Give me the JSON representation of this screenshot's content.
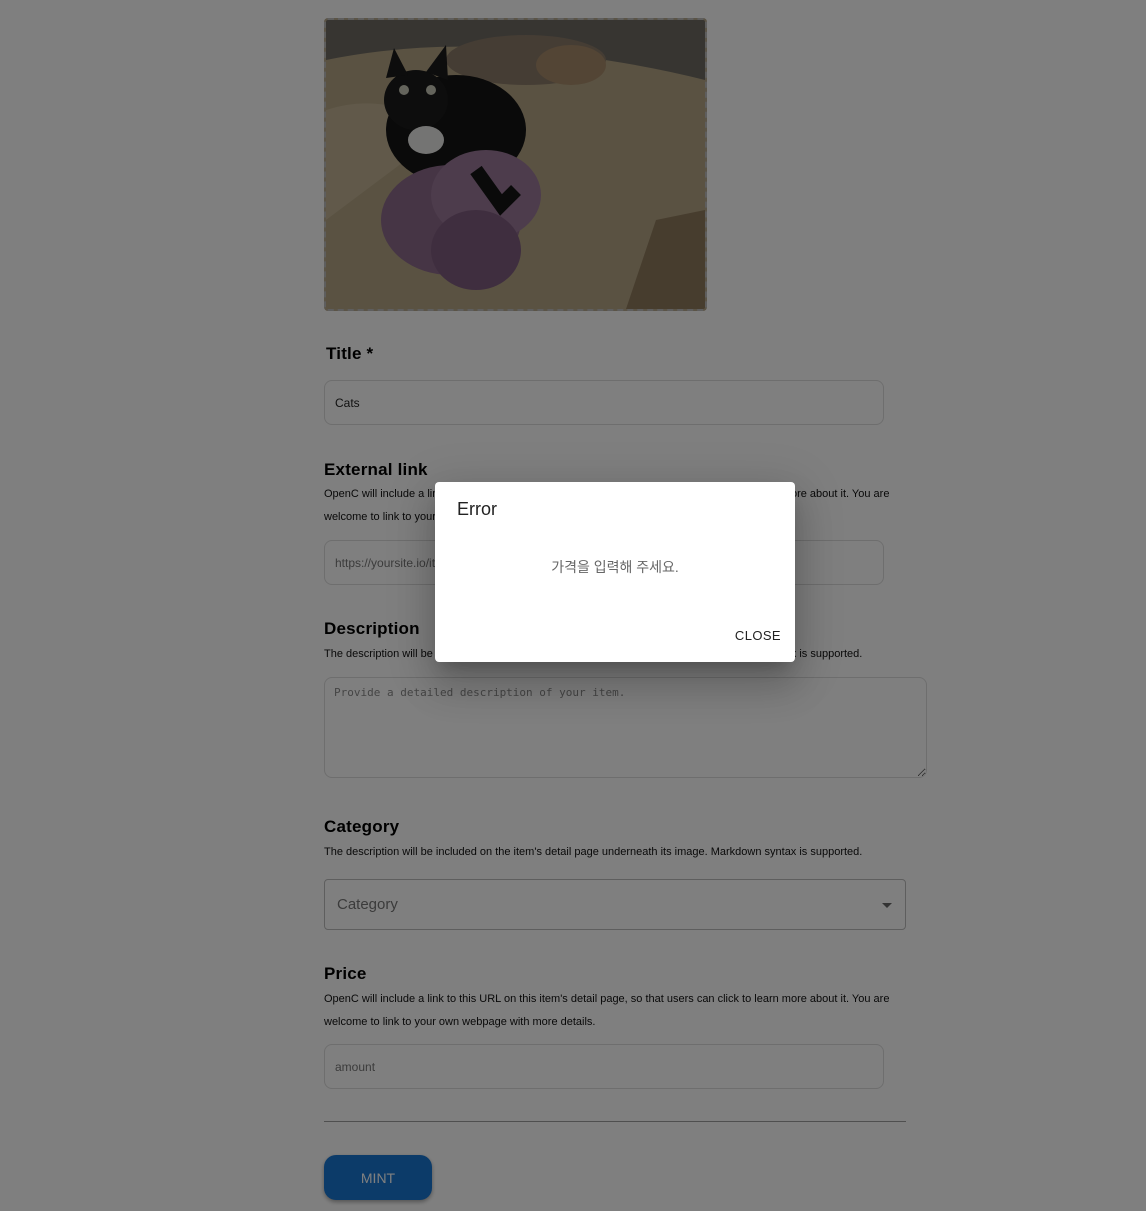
{
  "form": {
    "title_label": "Title *",
    "title_value": "Cats",
    "external_link": {
      "label": "External link",
      "help": "OpenC will include a link to this URL on this item's detail page, so that users can click to learn more about it. You are welcome to link to your own webpage with more details.",
      "placeholder": "https://yoursite.io/item/123"
    },
    "description": {
      "label": "Description",
      "help": "The description will be included on the item's detail page underneath its image. Markdown syntax is supported.",
      "placeholder": "Provide a detailed description of your item."
    },
    "category": {
      "label": "Category",
      "help": "The description will be included on the item's detail page underneath its image. Markdown syntax is supported.",
      "placeholder": "Category"
    },
    "price": {
      "label": "Price",
      "help": "OpenC will include a link to this URL on this item's detail page, so that users can click to learn more about it. You are welcome to link to your own webpage with more details.",
      "placeholder": "amount"
    },
    "mint_label": "MINT"
  },
  "dialog": {
    "title": "Error",
    "message": "가격을 입력해 주세요.",
    "close_label": "CLOSE"
  },
  "colors": {
    "primary": "#1976d2",
    "backdrop": "rgba(0,0,0,0.5)"
  }
}
